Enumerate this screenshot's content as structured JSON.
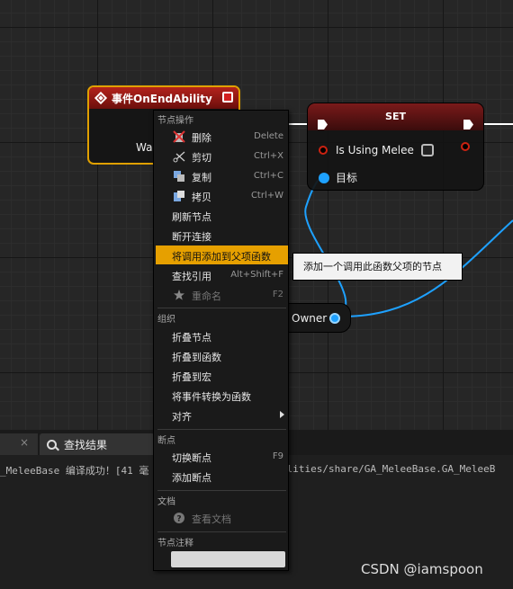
{
  "graph": {
    "event_node": {
      "title": "事件OnEndAbility",
      "pin_label": "Was"
    },
    "set_node": {
      "title": "SET",
      "var_label": "Is Using Melee",
      "target_label": "目标"
    },
    "owner_node": {
      "label": "Owner"
    },
    "tooltip": "添加一个调用此函数父项的节点"
  },
  "menu": {
    "node_actions": {
      "title": "节点操作",
      "items": [
        {
          "label": "删除",
          "shortcut": "Delete",
          "icon": "delete-icon"
        },
        {
          "label": "剪切",
          "shortcut": "Ctrl+X",
          "icon": "scissors-icon"
        },
        {
          "label": "复制",
          "shortcut": "Ctrl+C",
          "icon": "copy-icon"
        },
        {
          "label": "拷贝",
          "shortcut": "Ctrl+W",
          "icon": "duplicate-icon"
        },
        {
          "label": "刷新节点",
          "shortcut": ""
        },
        {
          "label": "断开连接",
          "shortcut": ""
        },
        {
          "label": "将调用添加到父项函数",
          "shortcut": "",
          "highlighted": true
        },
        {
          "label": "查找引用",
          "shortcut": "Alt+Shift+F"
        },
        {
          "label": "重命名",
          "shortcut": "F2",
          "icon": "star-icon",
          "disabled": true
        }
      ]
    },
    "organization": {
      "title": "组织",
      "items": [
        {
          "label": "折叠节点"
        },
        {
          "label": "折叠到函数"
        },
        {
          "label": "折叠到宏"
        },
        {
          "label": "将事件转换为函数"
        },
        {
          "label": "对齐",
          "submenu": true
        }
      ]
    },
    "breakpoints": {
      "title": "断点",
      "items": [
        {
          "label": "切换断点",
          "shortcut": "F9"
        },
        {
          "label": "添加断点",
          "shortcut": ""
        }
      ]
    },
    "docs": {
      "title": "文档",
      "items": [
        {
          "label": "查看文档",
          "icon": "help-icon",
          "disabled": true
        }
      ]
    },
    "comment": {
      "title": "节点注释",
      "value": ""
    }
  },
  "bottom": {
    "tab_close": "×",
    "find_tab": "查找结果",
    "log_left": "_MeleeBase 编译成功！[41 毫",
    "log_right": "ilities/share/GA_MeleeBase.GA_MeleeB"
  },
  "watermark": "CSDN @iamspoon",
  "colors": {
    "highlight": "#e6a000",
    "event_header": "#b3221c",
    "pin_blue": "#1ea1ff",
    "pin_red": "#cc2211"
  }
}
